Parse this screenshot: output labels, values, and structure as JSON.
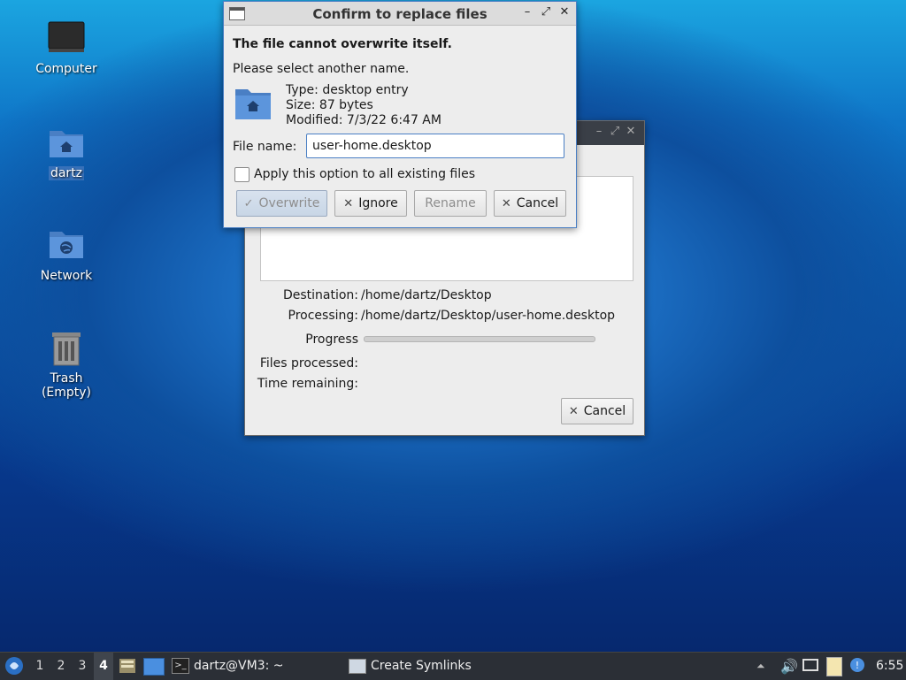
{
  "desktop": {
    "icons": [
      {
        "label": "Computer"
      },
      {
        "label": "dartz"
      },
      {
        "label": "Network"
      },
      {
        "label": "Trash (Empty)"
      }
    ]
  },
  "progress_window": {
    "destination_label": "Destination:",
    "destination_value": "/home/dartz/Desktop",
    "processing_label": "Processing:",
    "processing_value": "/home/dartz/Desktop/user-home.desktop",
    "progress_label": "Progress",
    "progress_fraction": 0.0,
    "files_processed_label": "Files processed:",
    "time_remaining_label": "Time remaining:",
    "cancel_label": "Cancel"
  },
  "dialog": {
    "title": "Confirm to replace files",
    "heading": "The file cannot overwrite itself.",
    "instruction": "Please select another name.",
    "type_text": "Type: desktop entry",
    "size_text": "Size: 87 bytes",
    "modified_text": "Modified: 7/3/22 6:47 AM",
    "filename_label": "File name:",
    "filename_value": "user-home.desktop",
    "apply_all_label": "Apply this option to all existing files",
    "apply_all_checked": false,
    "buttons": {
      "overwrite": "Overwrite",
      "ignore": "Ignore",
      "rename": "Rename",
      "cancel": "Cancel"
    }
  },
  "taskbar": {
    "workspaces": [
      "1",
      "2",
      "3",
      "4"
    ],
    "active_workspace": "4",
    "tasks": [
      {
        "label": "dartz@VM3: ~"
      },
      {
        "label": "Create Symlinks"
      }
    ],
    "clock": "6:55"
  }
}
